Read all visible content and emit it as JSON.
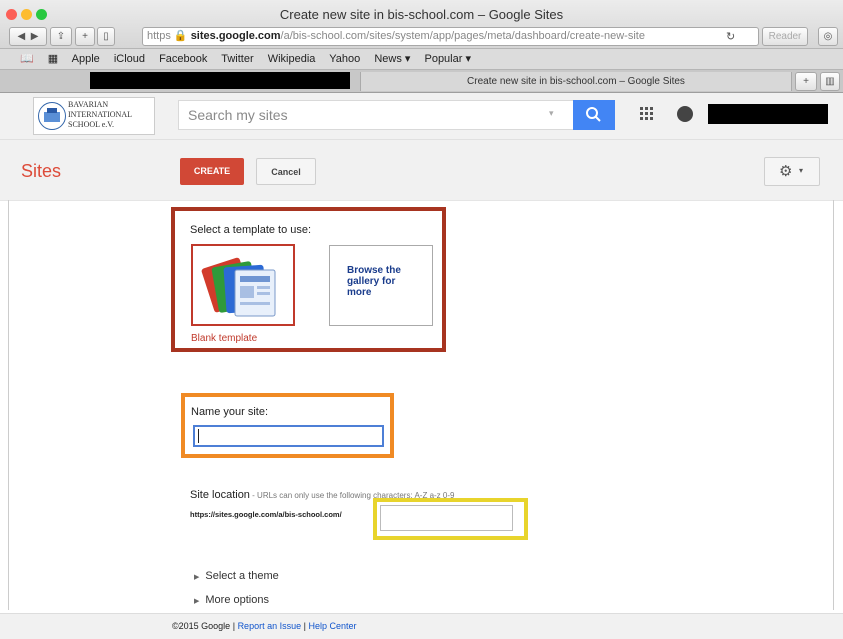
{
  "browser": {
    "window_title": "Create new site in bis-school.com – Google Sites",
    "url_scheme": "https",
    "url_domain": "sites.google.com",
    "url_path": "/a/bis-school.com/sites/system/app/pages/meta/dashboard/create-new-site",
    "reader_label": "Reader",
    "bookmarks": [
      "Apple",
      "iCloud",
      "Facebook",
      "Twitter",
      "Wikipedia",
      "Yahoo",
      "News ▾",
      "Popular ▾"
    ],
    "tab_title": "Create new site in bis-school.com – Google Sites"
  },
  "header": {
    "logo_line1": "BAVARIAN",
    "logo_line2": "INTERNATIONAL",
    "logo_line3": "SCHOOL e.V.",
    "search_placeholder": "Search my sites"
  },
  "toolbar": {
    "app_title": "Sites",
    "create_label": "CREATE",
    "cancel_label": "Cancel"
  },
  "template": {
    "heading": "Select a template to use:",
    "blank_label": "Blank template",
    "browse_label": "Browse the gallery for more"
  },
  "name": {
    "label": "Name your site:",
    "value": ""
  },
  "location": {
    "label": "Site location",
    "hint": " - URLs can only use the following characters: A-Z a-z 0-9",
    "prefix": "https://sites.google.com/a/bis-school.com/",
    "value": ""
  },
  "options": {
    "theme": "Select a theme",
    "more": "More options"
  },
  "footer": {
    "copyright": "©2015 Google",
    "sep": "|",
    "report": "Report an Issue",
    "help": "Help Center"
  },
  "colors": {
    "brand_red": "#dd4b39",
    "create_button": "#d14836",
    "search_blue": "#4285f4",
    "highlight_template": "#a73420",
    "highlight_name": "#f08a24",
    "highlight_location": "#e8d42c"
  }
}
